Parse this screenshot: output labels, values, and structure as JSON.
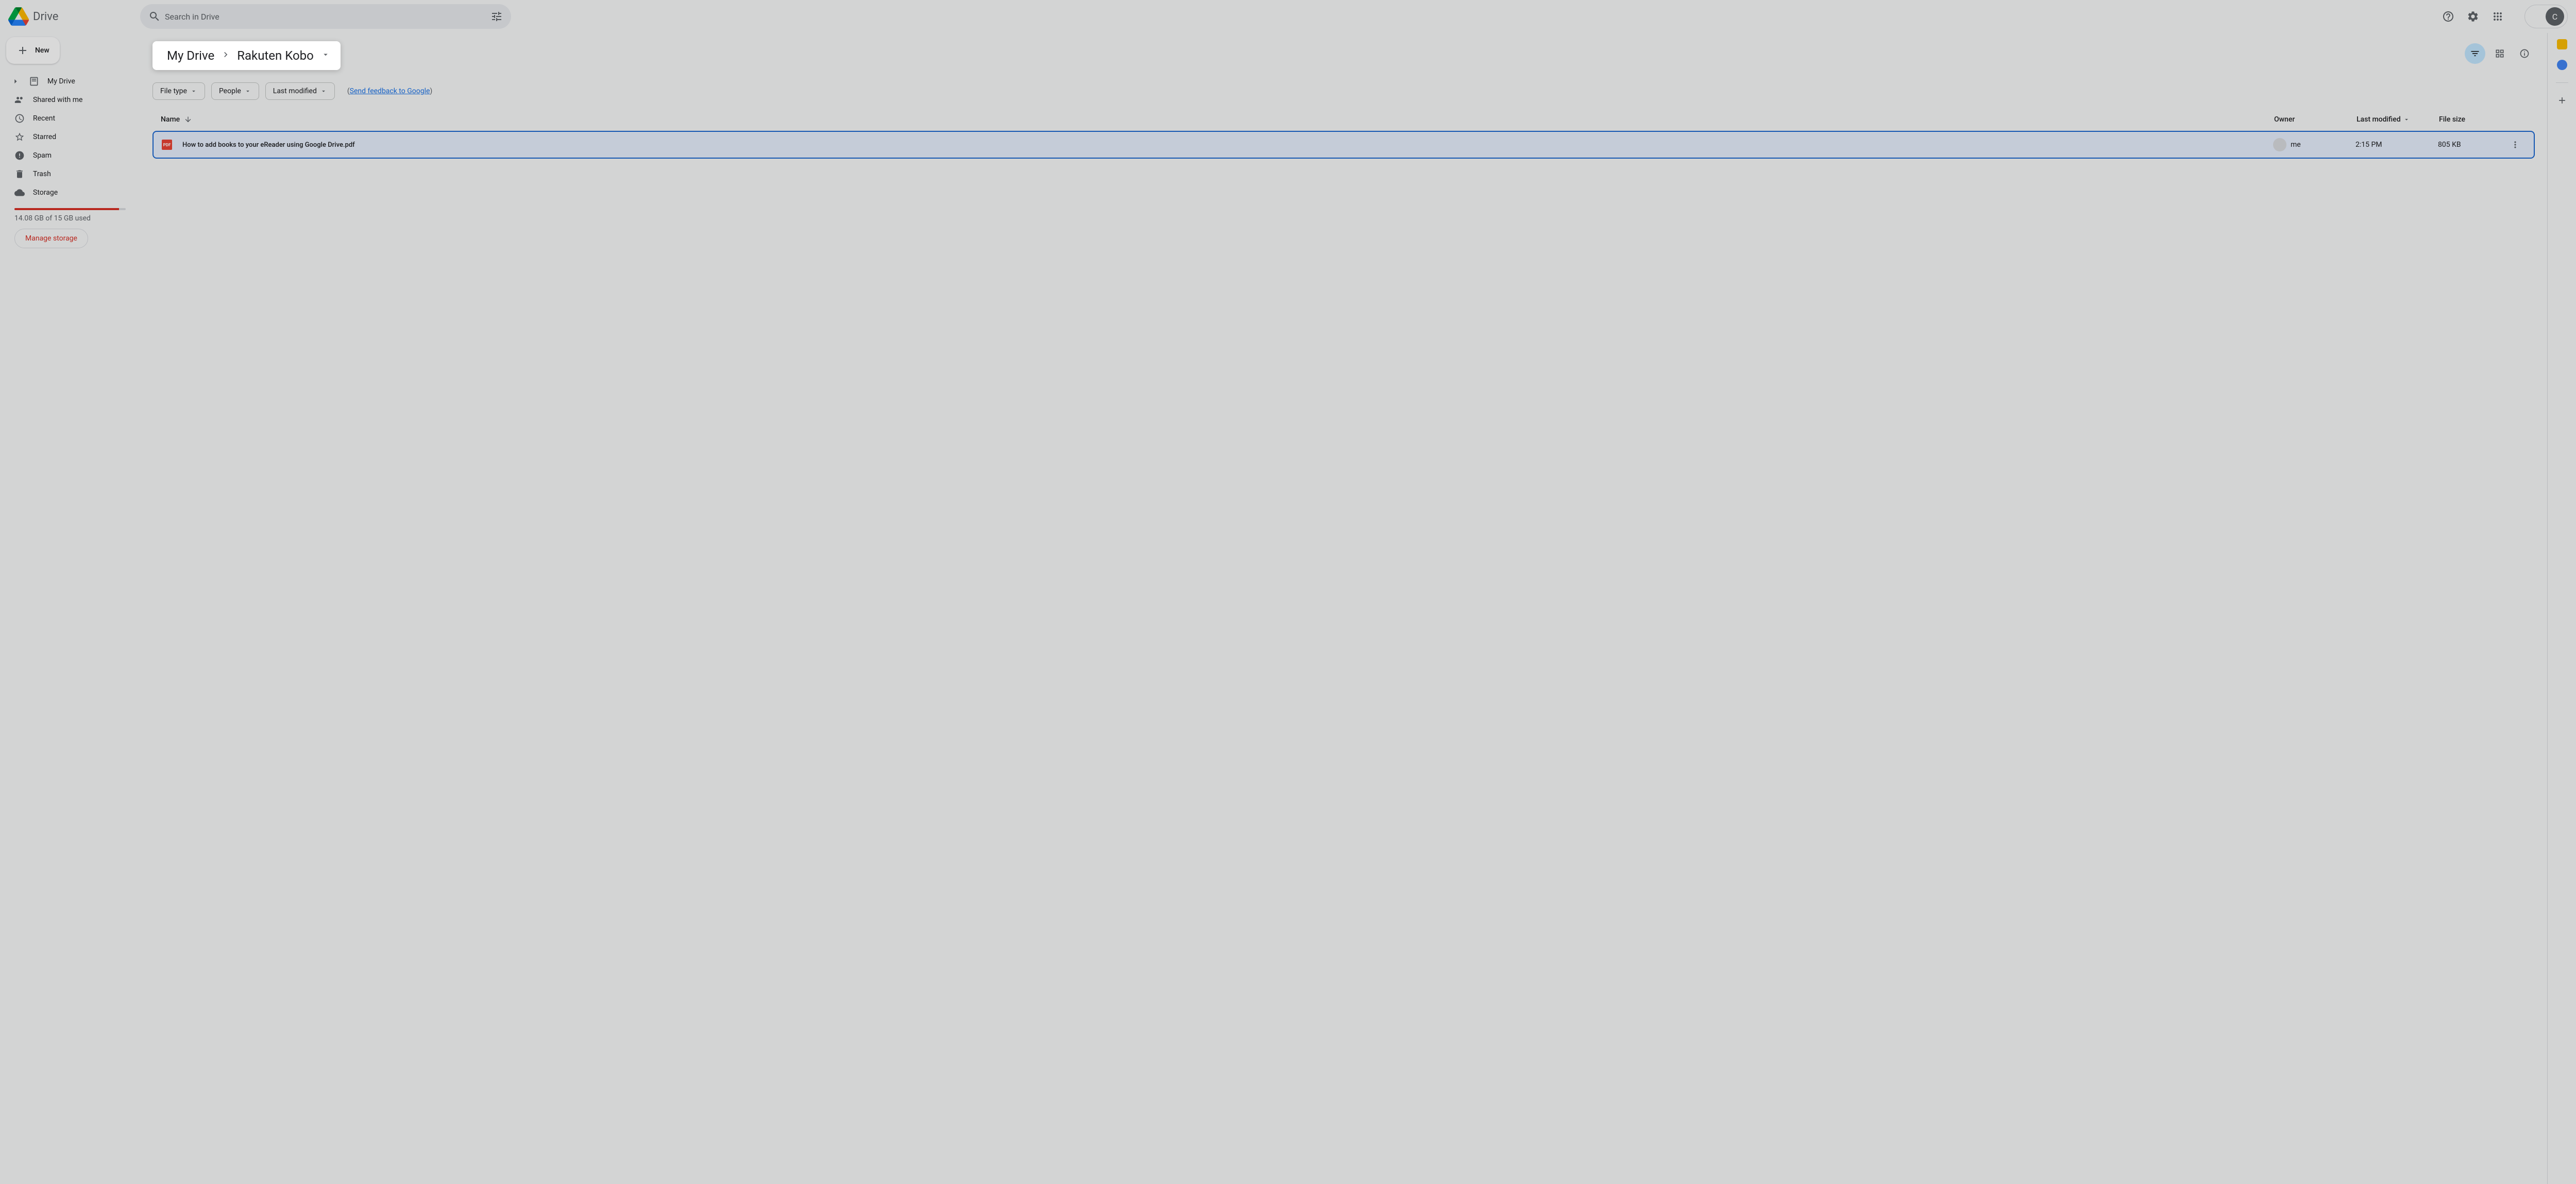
{
  "app": {
    "name": "Drive"
  },
  "search": {
    "placeholder": "Search in Drive"
  },
  "avatar": {
    "letter": "C"
  },
  "new_button": {
    "label": "New"
  },
  "sidebar": {
    "items": [
      {
        "label": "My Drive",
        "icon": "drive"
      },
      {
        "label": "Shared with me",
        "icon": "people"
      },
      {
        "label": "Recent",
        "icon": "clock"
      },
      {
        "label": "Starred",
        "icon": "star"
      },
      {
        "label": "Spam",
        "icon": "spam"
      },
      {
        "label": "Trash",
        "icon": "trash"
      },
      {
        "label": "Storage",
        "icon": "cloud"
      }
    ],
    "storage": {
      "percent": 94,
      "text": "14.08 GB of 15 GB used",
      "manage_label": "Manage storage"
    }
  },
  "breadcrumb": {
    "root": "My Drive",
    "current": "Rakuten Kobo"
  },
  "filters": {
    "file_type": "File type",
    "people": "People",
    "last_modified": "Last modified"
  },
  "feedback": {
    "prefix": "(",
    "link": "Send feedback to Google",
    "suffix": ")"
  },
  "columns": {
    "name": "Name",
    "owner": "Owner",
    "modified": "Last modified",
    "size": "File size"
  },
  "files": [
    {
      "name": "How to add books to your eReader using Google Drive.pdf",
      "owner": "me",
      "modified": "2:15 PM",
      "size": "805 KB",
      "type": "PDF"
    }
  ]
}
